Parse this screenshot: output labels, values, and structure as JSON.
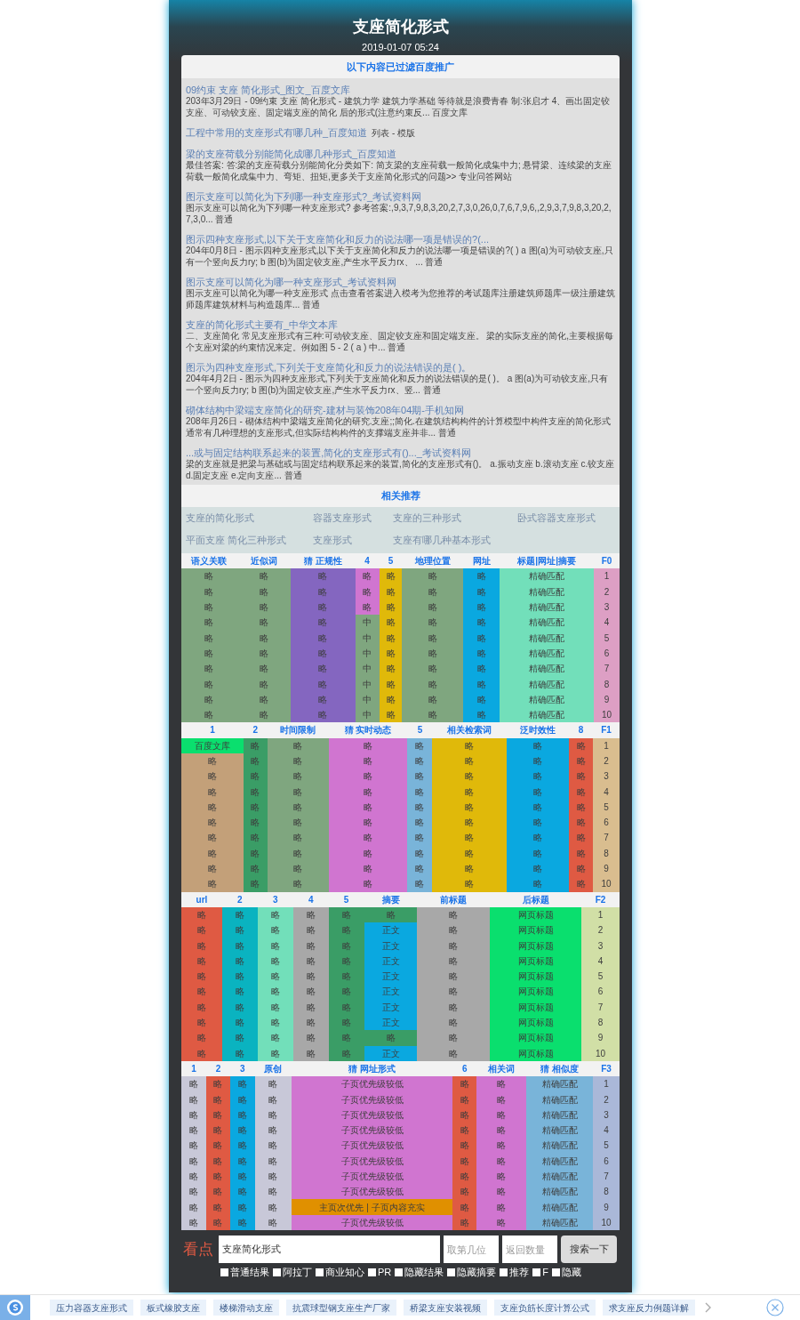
{
  "header": {
    "title": "支座简化形式",
    "date": "2019-01-07 05:24"
  },
  "notice": "以下内容已过滤百度推广",
  "results": [
    {
      "title": "09约束 支座 简化形式_图文_百度文库",
      "snippet": "203年3月29日 - 09约束 支座 简化形式 - 建筑力学 建筑力学基础 等待就是浪费青春 制:张启才 4、画出固定铰支座、可动铰支座、固定端支座的简化 后的形式(注意约束反... 百度文库"
    },
    {
      "title": "工程中常用的支座形式有哪几种_百度知道",
      "tag": "列表 - 模版"
    },
    {
      "title": "梁的支座荷载分别能简化成哪几种形式_百度知道",
      "snippet": "最佳答案: 答:梁的支座荷载分别能简化分类如下: 简支梁的支座荷载一般简化成集中力; 悬臂梁、连续梁的支座荷载一般简化成集中力、弯矩、扭矩,更多关于支座简化形式的问题>> 专业问答网站"
    },
    {
      "title": "图示支座可以简化为下列哪一种支座形式?_考试资料网",
      "snippet": "图示支座可以简化为下列哪一种支座形式? 参考答案:,9,3,7,9,8,3,20,2,7,3,0,26,0,7,6,7,9,6,,2,9,3,7,9,8,3,20,2,7,3,0... 普通"
    },
    {
      "title": "图示四种支座形式,以下关于支座简化和反力的说法哪一项是错误的?(...",
      "snippet": "204年0月8日 - 图示四种支座形式,以下关于支座简化和反力的说法哪一项是错误的?( ) a 图(a)为可动铰支座,只有一个竖向反力ry; b 图(b)为固定铰支座,产生水平反力rx、 ... 普通"
    },
    {
      "title": "图示支座可以简化为哪一种支座形式_考试资料网",
      "snippet": "图示支座可以简化为哪一种支座形式 点击查看答案进入模考为您推荐的考试题库注册建筑师题库一级注册建筑师题库建筑材料与构造题库... 普通"
    },
    {
      "title": "支座的简化形式主要有_中华文本库",
      "snippet": "二、支座简化 常见支座形式有三种:可动铰支座、固定铰支座和固定端支座。 梁的实际支座的简化,主要根据每个支座对梁的约束情况来定。例如图 5 - 2 ( a ) 中... 普通"
    },
    {
      "title": "图示为四种支座形式,下列关于支座简化和反力的说法错误的是( )。",
      "snippet": "204年4月2日 - 图示为四种支座形式,下列关于支座简化和反力的说法错误的是( )。 a 图(a)为可动铰支座,只有一个竖向反力ry; b 图(b)为固定铰支座,产生水平反力rx、竖... 普通"
    },
    {
      "title": "砌体结构中梁端支座简化的研究-建材与装饰208年04期-手机知网",
      "snippet": "208年月26日 - 砌体结构中梁端支座简化的研究.支座;;简化.在建筑结构构件的计算模型中构件支座的简化形式通常有几种理想的支座形式,但实际结构构件的支撑端支座并非... 普通"
    },
    {
      "title": "...或与固定结构联系起来的装置,简化的支座形式有()..._考试资料网",
      "snippet": "梁的支座就是把梁与基础或与固定结构联系起来的装置,简化的支座形式有()。 a.振动支座 b.滚动支座 c.铰支座 d.固定支座 e.定向支座... 普通"
    }
  ],
  "related": {
    "title": "相关推荐",
    "links": [
      "支座的简化形式",
      "容器支座形式",
      "支座的三种形式",
      "卧式容器支座形式",
      "平面支座 简化三种形式",
      "支座形式",
      "支座有哪几种基本形式"
    ]
  },
  "tables": [
    {
      "columns": [
        {
          "label": "语义关联",
          "color": "#7fa67f",
          "cells": [
            "略",
            "略",
            "略",
            "略",
            "略",
            "略",
            "略",
            "略",
            "略",
            "略"
          ]
        },
        {
          "label": "近似词",
          "color": "#7fa67f",
          "cells": [
            "略",
            "略",
            "略",
            "略",
            "略",
            "略",
            "略",
            "略",
            "略",
            "略"
          ]
        },
        {
          "label": "猜 正规性",
          "color": "#8466c0",
          "cells": [
            "略",
            "略",
            "略",
            "略",
            "略",
            "略",
            "略",
            "略",
            "略",
            "略"
          ]
        },
        {
          "label": "4",
          "color": "#7fa67f",
          "cells": [
            {
              "text": "略",
              "color": "#d075d0"
            },
            {
              "text": "略",
              "color": "#d075d0"
            },
            {
              "text": "略",
              "color": "#d075d0"
            },
            "中",
            "中",
            "中",
            "中",
            "中",
            "中",
            "中"
          ]
        },
        {
          "label": "5",
          "color": "#e0b90a",
          "cells": [
            "略",
            "略",
            "略",
            "略",
            "略",
            "略",
            "略",
            "略",
            "略",
            "略"
          ]
        },
        {
          "label": "地理位置",
          "color": "#7fa67f",
          "cells": [
            "略",
            "略",
            "略",
            "略",
            "略",
            "略",
            "略",
            "略",
            "略",
            "略"
          ]
        },
        {
          "label": "网址",
          "color": "#0aa8e0",
          "cells": [
            "略",
            "略",
            "略",
            "略",
            "略",
            "略",
            "略",
            "略",
            "略",
            "略"
          ]
        },
        {
          "label": "标题|网址|摘要",
          "color": "#72dfba",
          "cells": [
            "精确匹配",
            "精确匹配",
            "精确匹配",
            "精确匹配",
            "精确匹配",
            "精确匹配",
            "精确匹配",
            "精确匹配",
            "精确匹配",
            "精确匹配"
          ]
        },
        {
          "label": "F0",
          "color": "#dd9fc4",
          "cells": [
            "1",
            "2",
            "3",
            "4",
            "5",
            "6",
            "7",
            "8",
            "9",
            "10"
          ]
        }
      ]
    },
    {
      "columns": [
        {
          "label": "1",
          "color": "#c3a079",
          "cells": [
            {
              "text": "百度文库",
              "color": "#0adf6e"
            },
            "略",
            "略",
            "略",
            "略",
            "略",
            "略",
            "略",
            "略",
            "略"
          ]
        },
        {
          "label": "2",
          "color": "#3a9d66",
          "cells": [
            "略",
            "略",
            "略",
            "略",
            "略",
            "略",
            "略",
            "略",
            "略",
            "略"
          ]
        },
        {
          "label": "时间限制",
          "color": "#7fa67f",
          "cells": [
            "略",
            "略",
            "略",
            "略",
            "略",
            "略",
            "略",
            "略",
            "略",
            "略"
          ]
        },
        {
          "label": "猜 实时动态",
          "color": "#d075d0",
          "cells": [
            "略",
            "略",
            "略",
            "略",
            "略",
            "略",
            "略",
            "略",
            "略",
            "略"
          ]
        },
        {
          "label": "5",
          "color": "#79b4d9",
          "cells": [
            "略",
            "略",
            "略",
            "略",
            "略",
            "略",
            "略",
            "略",
            "略",
            "略"
          ]
        },
        {
          "label": "相关检索词",
          "color": "#e0b90a",
          "cells": [
            "略",
            "略",
            "略",
            "略",
            "略",
            "略",
            "略",
            "略",
            "略",
            "略"
          ]
        },
        {
          "label": "泛时效性",
          "color": "#0aa8e0",
          "cells": [
            "略",
            "略",
            "略",
            "略",
            "略",
            "略",
            "略",
            "略",
            "略",
            "略"
          ]
        },
        {
          "label": "8",
          "color": "#df5a43",
          "cells": [
            "略",
            "略",
            "略",
            "略",
            "略",
            "略",
            "略",
            "略",
            "略",
            "略"
          ]
        },
        {
          "label": "F1",
          "color": "#d9bd8f",
          "cells": [
            "1",
            "2",
            "3",
            "4",
            "5",
            "6",
            "7",
            "8",
            "9",
            "10"
          ]
        }
      ]
    },
    {
      "columns": [
        {
          "label": "url",
          "color": "#df5a43",
          "cells": [
            "略",
            "略",
            "略",
            "略",
            "略",
            "略",
            "略",
            "略",
            "略",
            "略"
          ]
        },
        {
          "label": "2",
          "color": "#0ab3c0",
          "cells": [
            "略",
            "略",
            "略",
            "略",
            "略",
            "略",
            "略",
            "略",
            "略",
            "略"
          ]
        },
        {
          "label": "3",
          "color": "#72dfba",
          "cells": [
            "略",
            "略",
            "略",
            "略",
            "略",
            "略",
            "略",
            "略",
            "略",
            "略"
          ]
        },
        {
          "label": "4",
          "color": "#a8a8a8",
          "cells": [
            "略",
            "略",
            "略",
            "略",
            "略",
            "略",
            "略",
            "略",
            "略",
            "略"
          ]
        },
        {
          "label": "5",
          "color": "#3a9d66",
          "cells": [
            "略",
            "略",
            "略",
            "略",
            "略",
            "略",
            "略",
            "略",
            "略",
            "略"
          ]
        },
        {
          "label": "摘要",
          "color": "#0aa8e0",
          "cells": [
            {
              "text": "略",
              "color": "#3a9d66"
            },
            "正文",
            "正文",
            "正文",
            "正文",
            "正文",
            "正文",
            "正文",
            {
              "text": "略",
              "color": "#3a9d66"
            },
            "正文"
          ]
        },
        {
          "label": "前标题",
          "color": "#a8a8a8",
          "cells": [
            "略",
            "略",
            "略",
            "略",
            "略",
            "略",
            "略",
            "略",
            "略",
            "略"
          ]
        },
        {
          "label": "后标题",
          "color": "#0adf6e",
          "cells": [
            "网页标题",
            "网页标题",
            "网页标题",
            "网页标题",
            "网页标题",
            "网页标题",
            "网页标题",
            "网页标题",
            "网页标题",
            "网页标题"
          ]
        },
        {
          "label": "F2",
          "color": "#d1dfa6",
          "cells": [
            "1",
            "2",
            "3",
            "4",
            "5",
            "6",
            "7",
            "8",
            "9",
            "10"
          ]
        }
      ]
    },
    {
      "columns": [
        {
          "label": "1",
          "color": "#c8c8d8",
          "cells": [
            "略",
            "略",
            "略",
            "略",
            "略",
            "略",
            "略",
            "略",
            "略",
            "略"
          ]
        },
        {
          "label": "2",
          "color": "#df5a43",
          "cells": [
            "略",
            "略",
            "略",
            "略",
            "略",
            "略",
            "略",
            "略",
            "略",
            "略"
          ]
        },
        {
          "label": "3",
          "color": "#0aa8e0",
          "cells": [
            "略",
            "略",
            "略",
            "略",
            "略",
            "略",
            "略",
            "略",
            "略",
            "略"
          ]
        },
        {
          "label": "原创",
          "color": "#c8c8d8",
          "cells": [
            "略",
            "略",
            "略",
            "略",
            "略",
            "略",
            "略",
            "略",
            "略",
            "略"
          ]
        },
        {
          "label": "猜 网址形式",
          "color": "#d075d0",
          "cells": [
            "子页优先级较低",
            "子页优先级较低",
            "子页优先级较低",
            "子页优先级较低",
            "子页优先级较低",
            "子页优先级较低",
            "子页优先级较低",
            "子页优先级较低",
            {
              "text": "主页次优先 | 子页内容充实",
              "color": "#e09000"
            },
            "子页优先级较低"
          ]
        },
        {
          "label": "6",
          "color": "#df5a43",
          "cells": [
            "略",
            "略",
            "略",
            "略",
            "略",
            "略",
            "略",
            "略",
            "略",
            "略"
          ]
        },
        {
          "label": "相关词",
          "color": "#d075d0",
          "cells": [
            "略",
            "略",
            "略",
            "略",
            "略",
            "略",
            "略",
            "略",
            "略",
            "略"
          ]
        },
        {
          "label": "猜 相似度",
          "color": "#79b4d9",
          "cells": [
            "精确匹配",
            "精确匹配",
            "精确匹配",
            "精确匹配",
            "精确匹配",
            "精确匹配",
            "精确匹配",
            "精确匹配",
            "精确匹配",
            "精确匹配"
          ]
        },
        {
          "label": "F3",
          "color": "#aab8d8",
          "cells": [
            "1",
            "2",
            "3",
            "4",
            "5",
            "6",
            "7",
            "8",
            "9",
            "10"
          ]
        }
      ]
    }
  ],
  "search": {
    "brand": "看点",
    "query": "支座简化形式",
    "fields": [
      {
        "placeholder": "取第几位"
      },
      {
        "placeholder": "返回数量"
      }
    ],
    "button": "搜索一下",
    "options": [
      {
        "label": "普通结果",
        "checked": false
      },
      {
        "label": "阿拉丁",
        "checked": false
      },
      {
        "label": "商业知心",
        "checked": false
      },
      {
        "label": "PR",
        "checked": false
      },
      {
        "label": "隐藏结果",
        "checked": false
      },
      {
        "label": "隐藏摘要",
        "checked": false
      },
      {
        "label": "推荐",
        "checked": false
      },
      {
        "label": "F",
        "checked": false
      },
      {
        "label": "隐藏",
        "checked": false
      }
    ]
  },
  "bottom_bar": {
    "tags": [
      "压力容器支座形式",
      "板式橡胶支座",
      "楼梯滑动支座",
      "抗震球型钢支座生产厂家",
      "桥梁支座安装视频",
      "支座负筋长度计算公式",
      "求支座反力例题详解"
    ]
  }
}
